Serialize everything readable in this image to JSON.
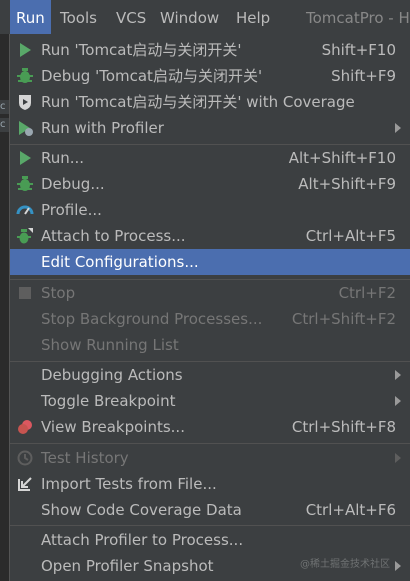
{
  "menubar": {
    "items": [
      {
        "label": "Run"
      },
      {
        "label": "Tools"
      },
      {
        "label": "VCS"
      },
      {
        "label": "Window"
      },
      {
        "label": "Help"
      }
    ],
    "title": "TomcatPro - H"
  },
  "left_strip": {
    "frag1": "c",
    "frag2": "c"
  },
  "menu": {
    "groups": [
      [
        {
          "label": "Run 'Tomcat启动与关闭开关'",
          "shortcut": "Shift+F10",
          "icon": "run-icon"
        },
        {
          "label": "Debug 'Tomcat启动与关闭开关'",
          "shortcut": "Shift+F9",
          "icon": "debug-icon"
        },
        {
          "label": "Run 'Tomcat启动与关闭开关' with Coverage",
          "shortcut": "",
          "icon": "coverage-icon"
        },
        {
          "label": "Run with Profiler",
          "shortcut": "",
          "icon": "profiler-icon",
          "submenu": true
        }
      ],
      [
        {
          "label": "Run...",
          "shortcut": "Alt+Shift+F10",
          "icon": "run-icon"
        },
        {
          "label": "Debug...",
          "shortcut": "Alt+Shift+F9",
          "icon": "debug-icon"
        },
        {
          "label": "Profile...",
          "shortcut": "",
          "icon": "profile-gauge-icon"
        },
        {
          "label": "Attach to Process...",
          "shortcut": "Ctrl+Alt+F5",
          "icon": "attach-icon"
        },
        {
          "label": "Edit Configurations...",
          "shortcut": "",
          "icon": "",
          "selected": true
        }
      ],
      [
        {
          "label": "Stop",
          "shortcut": "Ctrl+F2",
          "icon": "stop-icon",
          "disabled": true
        },
        {
          "label": "Stop Background Processes...",
          "shortcut": "Ctrl+Shift+F2",
          "icon": "",
          "disabled": true
        },
        {
          "label": "Show Running List",
          "shortcut": "",
          "icon": "",
          "disabled": true
        }
      ],
      [
        {
          "label": "Debugging Actions",
          "shortcut": "",
          "icon": "",
          "submenu": true
        },
        {
          "label": "Toggle Breakpoint",
          "shortcut": "",
          "icon": "",
          "submenu": true
        },
        {
          "label": "View Breakpoints...",
          "shortcut": "Ctrl+Shift+F8",
          "icon": "breakpoints-icon"
        }
      ],
      [
        {
          "label": "Test History",
          "shortcut": "",
          "icon": "history-icon",
          "disabled": true,
          "submenu": true
        },
        {
          "label": "Import Tests from File...",
          "shortcut": "",
          "icon": "import-icon"
        },
        {
          "label": "Show Code Coverage Data",
          "shortcut": "Ctrl+Alt+F6",
          "icon": ""
        }
      ],
      [
        {
          "label": "Attach Profiler to Process...",
          "shortcut": "",
          "icon": ""
        },
        {
          "label": "Open Profiler Snapshot",
          "shortcut": "",
          "icon": "",
          "submenu": true
        }
      ]
    ]
  },
  "watermark": "@稀土掘金技术社区",
  "colors": {
    "selection": "#4b6eaf",
    "background": "#3c3f41",
    "run": "#59a869",
    "debug": "#499c54",
    "breakpoint": "#db5860"
  }
}
